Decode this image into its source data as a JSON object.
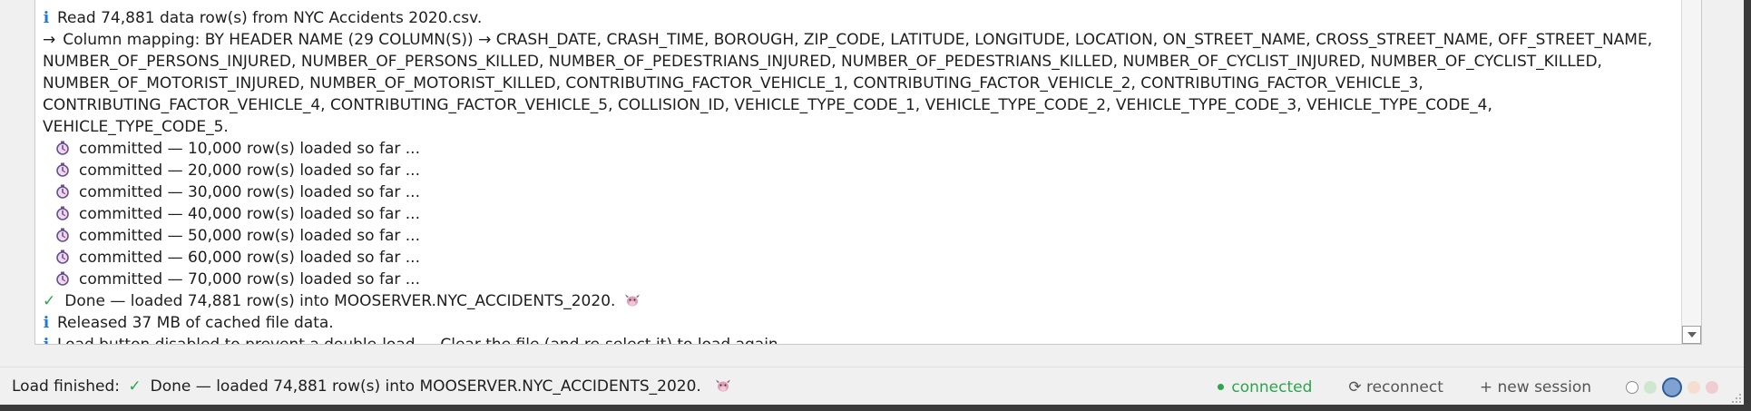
{
  "log": {
    "lines": [
      {
        "type": "info",
        "text": "Read 74,881 data row(s) from NYC Accidents 2020.csv."
      },
      {
        "type": "mapping",
        "text": "Column mapping: BY HEADER NAME (29 COLUMN(S)) → CRASH_DATE, CRASH_TIME, BOROUGH, ZIP_CODE, LATITUDE, LONGITUDE, LOCATION, ON_STREET_NAME, CROSS_STREET_NAME, OFF_STREET_NAME, NUMBER_OF_PERSONS_INJURED, NUMBER_OF_PERSONS_KILLED, NUMBER_OF_PEDESTRIANS_INJURED, NUMBER_OF_PEDESTRIANS_KILLED, NUMBER_OF_CYCLIST_INJURED, NUMBER_OF_CYCLIST_KILLED, NUMBER_OF_MOTORIST_INJURED, NUMBER_OF_MOTORIST_KILLED, CONTRIBUTING_FACTOR_VEHICLE_1, CONTRIBUTING_FACTOR_VEHICLE_2, CONTRIBUTING_FACTOR_VEHICLE_3, CONTRIBUTING_FACTOR_VEHICLE_4, CONTRIBUTING_FACTOR_VEHICLE_5, COLLISION_ID, VEHICLE_TYPE_CODE_1, VEHICLE_TYPE_CODE_2, VEHICLE_TYPE_CODE_3, VEHICLE_TYPE_CODE_4, VEHICLE_TYPE_CODE_5."
      },
      {
        "type": "progress",
        "text": "committed — 10,000 row(s) loaded so far ..."
      },
      {
        "type": "progress",
        "text": "committed — 20,000 row(s) loaded so far ..."
      },
      {
        "type": "progress",
        "text": "committed — 30,000 row(s) loaded so far ..."
      },
      {
        "type": "progress",
        "text": "committed — 40,000 row(s) loaded so far ..."
      },
      {
        "type": "progress",
        "text": "committed — 50,000 row(s) loaded so far ..."
      },
      {
        "type": "progress",
        "text": "committed — 60,000 row(s) loaded so far ..."
      },
      {
        "type": "progress",
        "text": "committed — 70,000 row(s) loaded so far ..."
      },
      {
        "type": "done",
        "text": "Done — loaded 74,881 row(s) into MOOSERVER.NYC_ACCIDENTS_2020."
      },
      {
        "type": "info",
        "text": "Released 37 MB of cached file data."
      },
      {
        "type": "info",
        "text": "Load button disabled to prevent a double-load — Clear the file (and re-select it) to load again."
      }
    ],
    "icons": {
      "info": "info-icon",
      "mapping": "arrow-right-icon",
      "progress": "stopwatch-icon",
      "done": "check-icon",
      "trailing": "cow-icon"
    },
    "glyphs": {
      "info": "i",
      "mapping": "→",
      "done": "✓"
    }
  },
  "status_bar": {
    "prefix": "Load finished:",
    "check_glyph": "✓",
    "message": "Done — loaded 74,881 row(s) into MOOSERVER.NYC_ACCIDENTS_2020.",
    "connection": "connected",
    "reconnect_label": "⟳ reconnect",
    "new_session_label": "+ new session"
  },
  "colors": {
    "info": "#1f78d1",
    "success": "#2da44e",
    "text": "#1e1e1e",
    "muted": "#555555",
    "selected_ring": "#2b5b9a"
  },
  "themes": [
    {
      "name": "light",
      "color": "#ffffff",
      "border": "#8a8a8a",
      "selected": false
    },
    {
      "name": "mint",
      "color": "#cfe6cf",
      "border": "#cfe6cf",
      "selected": false
    },
    {
      "name": "blue",
      "color": "#7fa3d1",
      "border": "#2b5b9a",
      "selected": true
    },
    {
      "name": "peach",
      "color": "#f5ded0",
      "border": "#f5ded0",
      "selected": false
    },
    {
      "name": "rose",
      "color": "#f0cdd2",
      "border": "#f0cdd2",
      "selected": false
    }
  ]
}
